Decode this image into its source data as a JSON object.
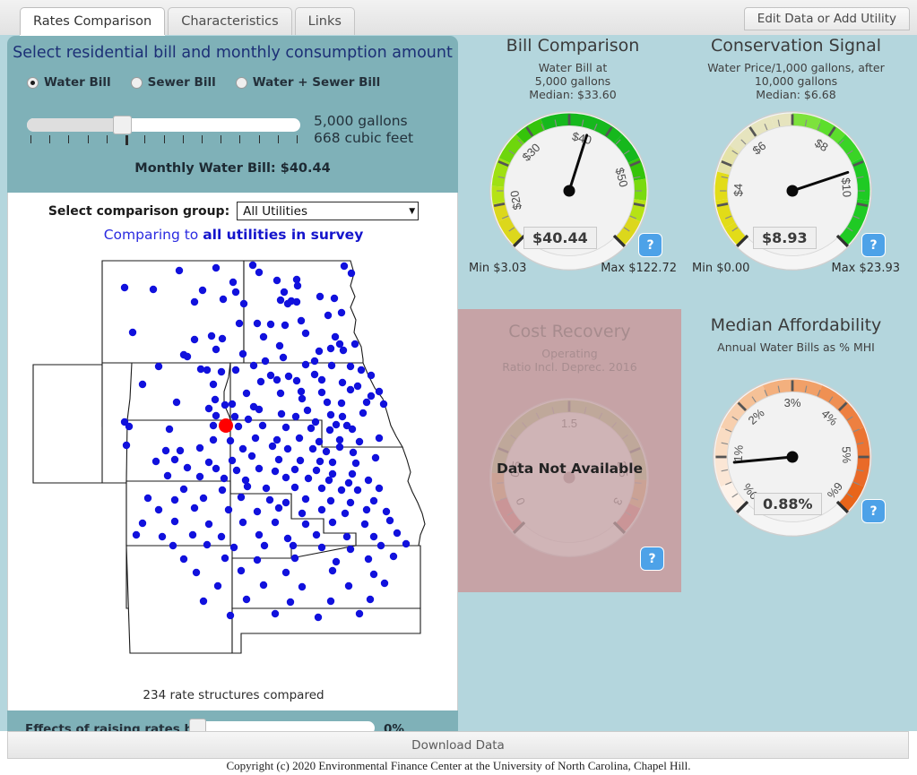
{
  "tabs": [
    {
      "label": "Rates Comparison",
      "active": true
    },
    {
      "label": "Characteristics",
      "active": false
    },
    {
      "label": "Links",
      "active": false
    }
  ],
  "header": {
    "edit_button": "Edit Data or Add Utility"
  },
  "selector": {
    "title": "Select residential bill and monthly consumption amount",
    "options": [
      {
        "label": "Water Bill",
        "selected": true
      },
      {
        "label": "Sewer Bill",
        "selected": false
      },
      {
        "label": "Water + Sewer Bill",
        "selected": false
      }
    ],
    "consumption_gallons": "5,000 gallons",
    "consumption_cubic_feet": "668 cubic feet",
    "bill_total": "Monthly Water Bill: $40.44"
  },
  "comparison": {
    "label": "Select comparison group:",
    "selected_group": "All Utilities",
    "caret": "▼",
    "subtitle_prefix": "Comparing to ",
    "subtitle_strong": "all utilities in survey",
    "map_caption": "234 rate structures compared"
  },
  "raise_rates": {
    "label": "Effects of raising rates by:",
    "value": "0%"
  },
  "panels": {
    "bill_comparison": {
      "title": "Bill Comparison",
      "sub_line1": "Water Bill at",
      "sub_line2": "5,000 gallons",
      "sub_line3": "Median: $33.60",
      "value": "$40.44",
      "min": "Min $3.03",
      "max": "Max $122.72",
      "help": "?"
    },
    "conservation_signal": {
      "title": "Conservation Signal",
      "sub_line1": "Water Price/1,000 gallons, after",
      "sub_line2": "10,000 gallons",
      "sub_line3": "Median: $6.68",
      "value": "$8.93",
      "min": "Min $0.00",
      "max": "Max $23.93",
      "help": "?"
    },
    "cost_recovery": {
      "title": "Cost Recovery",
      "sub_line1": "Operating",
      "sub_line2": "Ratio Incl. Deprec. 2016",
      "not_available": "Data Not Available",
      "help": "?"
    },
    "median_affordability": {
      "title": "Median Affordability",
      "sub_line1": "Annual Water Bills as % MHI",
      "value": "0.88%",
      "help": "?"
    }
  },
  "footer": {
    "download": "Download Data",
    "copyright": "Copyright (c) 2020 Environmental Finance Center at the University of North Carolina, Chapel Hill."
  },
  "chart_data": [
    {
      "type": "gauge",
      "name": "bill-comparison-gauge",
      "title": "Bill Comparison",
      "value": 40.44,
      "unit": "$",
      "min": 12,
      "max": 58,
      "axis_min_label": "Min $3.03",
      "axis_max_label": "Max $122.72",
      "median": 33.6,
      "tick_labels": [
        "$20",
        "$30",
        "$40",
        "$50"
      ],
      "tick_values": [
        20,
        30,
        40,
        50
      ],
      "band_colors": [
        "#e0dc20",
        "#aede10",
        "#56cc0a",
        "#19b81b"
      ],
      "display_value": "$40.44"
    },
    {
      "type": "gauge",
      "name": "conservation-signal-gauge",
      "title": "Conservation Signal",
      "value": 8.93,
      "unit": "$",
      "min": 2,
      "max": 12,
      "axis_min_label": "Min $0.00",
      "axis_max_label": "Max $23.93",
      "median": 6.68,
      "tick_labels": [
        "$4",
        "$6",
        "$8",
        "$10"
      ],
      "tick_values": [
        4,
        6,
        8,
        10
      ],
      "band_colors": [
        "#e2dc18",
        "#e4e2b4",
        "#7ae03c",
        "#1fca24"
      ],
      "display_value": "$8.93"
    },
    {
      "type": "gauge",
      "name": "cost-recovery-gauge",
      "title": "Cost Recovery",
      "value": null,
      "min": 0,
      "max": 3,
      "tick_labels": [
        "0",
        "0.5",
        "1.5",
        "2.5",
        "3"
      ],
      "tick_values": [
        0,
        0.5,
        1.5,
        2.5,
        3
      ],
      "band_colors": [
        "#d86060",
        "#e0b060",
        "#a8bb70"
      ],
      "display_value": "Data Not Available"
    },
    {
      "type": "gauge",
      "name": "median-affordability-gauge",
      "title": "Median Affordability",
      "value": 0.88,
      "unit": "%",
      "min": 0,
      "max": 6,
      "tick_labels": [
        "0%",
        "1%",
        "2%",
        "3%",
        "4%",
        "5%",
        "6%"
      ],
      "tick_values": [
        0,
        1,
        2,
        3,
        4,
        5,
        6
      ],
      "band_colors": [
        "#fdf0e6",
        "#f7c9a4",
        "#ef8c44",
        "#e8651a"
      ],
      "display_value": "0.88%"
    },
    {
      "type": "scatter",
      "name": "utility-location-map",
      "title": "Comparing to all utilities in survey",
      "caption": "234 rate structures compared",
      "point_count": 234,
      "highlight_color": "#ff0000",
      "point_color": "#1111dd"
    }
  ]
}
